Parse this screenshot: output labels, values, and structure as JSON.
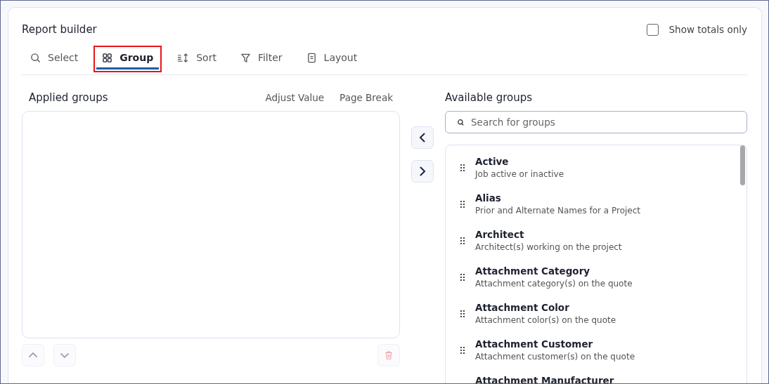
{
  "title": "Report builder",
  "show_totals": {
    "label": "Show totals only",
    "checked": false
  },
  "tabs": [
    {
      "label": "Select",
      "selected": false,
      "highlighted": false
    },
    {
      "label": "Group",
      "selected": true,
      "highlighted": true
    },
    {
      "label": "Sort",
      "selected": false,
      "highlighted": false
    },
    {
      "label": "Filter",
      "selected": false,
      "highlighted": false
    },
    {
      "label": "Layout",
      "selected": false,
      "highlighted": false
    }
  ],
  "applied": {
    "title": "Applied groups",
    "columns": [
      "Adjust Value",
      "Page Break"
    ]
  },
  "available": {
    "title": "Available groups",
    "search": {
      "placeholder": "Search for groups"
    },
    "items": [
      {
        "name": "Active",
        "description": "Job active or inactive"
      },
      {
        "name": "Alias",
        "description": "Prior and Alternate Names for a Project"
      },
      {
        "name": "Architect",
        "description": "Architect(s) working on the project"
      },
      {
        "name": "Attachment Category",
        "description": "Attachment category(s) on the quote"
      },
      {
        "name": "Attachment Color",
        "description": "Attachment color(s) on the quote"
      },
      {
        "name": "Attachment Customer",
        "description": "Attachment customer(s) on the quote"
      },
      {
        "name": "Attachment Manufacturer"
      }
    ]
  }
}
